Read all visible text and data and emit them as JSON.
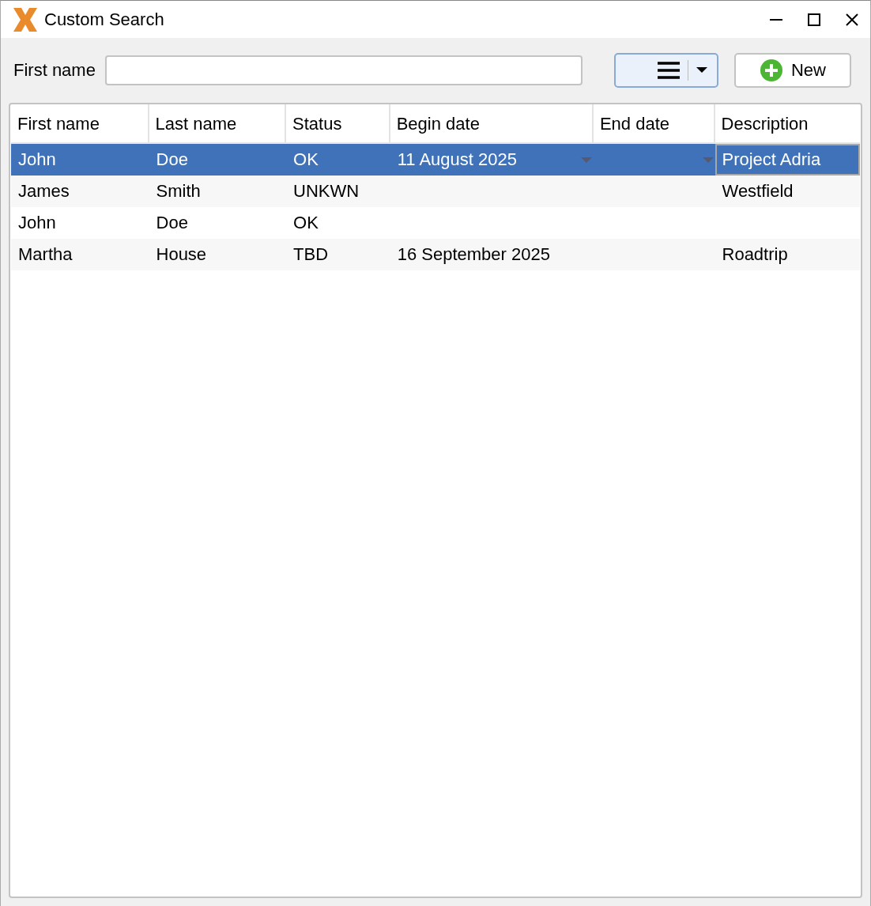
{
  "window": {
    "title": "Custom Search"
  },
  "filter": {
    "label": "First name"
  },
  "new_button": {
    "label": "New"
  },
  "table": {
    "columns": [
      {
        "label": "First name",
        "kind": "text"
      },
      {
        "label": "Last name",
        "kind": "text"
      },
      {
        "label": "Status",
        "kind": "text"
      },
      {
        "label": "Begin date",
        "kind": "date"
      },
      {
        "label": "End date",
        "kind": "date"
      },
      {
        "label": "Description",
        "kind": "text"
      }
    ],
    "rows": [
      {
        "selected": true,
        "cells": [
          {
            "text": "John",
            "focused": false
          },
          {
            "text": "Doe",
            "focused": false
          },
          {
            "text": "OK",
            "focused": false
          },
          {
            "text": "11 August 2025",
            "focused": false
          },
          {
            "focused": false
          },
          {
            "text": "Project Adria",
            "focused": true
          }
        ]
      },
      {
        "selected": false,
        "cells": [
          {
            "text": "James",
            "focused": false
          },
          {
            "text": "Smith",
            "focused": false
          },
          {
            "text": "UNKWN",
            "focused": false
          },
          {
            "focused": false
          },
          {
            "focused": false
          },
          {
            "text": "Westfield",
            "focused": false
          }
        ]
      },
      {
        "selected": false,
        "cells": [
          {
            "text": "John",
            "focused": false
          },
          {
            "text": "Doe",
            "focused": false
          },
          {
            "text": "OK",
            "focused": false
          },
          {
            "focused": false
          },
          {
            "focused": false
          },
          {
            "focused": false
          }
        ]
      },
      {
        "selected": false,
        "cells": [
          {
            "text": "Martha",
            "focused": false
          },
          {
            "text": "House",
            "focused": false
          },
          {
            "text": "TBD",
            "focused": false
          },
          {
            "text": "16 September 2025",
            "focused": false
          },
          {
            "focused": false
          },
          {
            "text": "Roadtrip",
            "focused": false
          }
        ]
      }
    ]
  }
}
